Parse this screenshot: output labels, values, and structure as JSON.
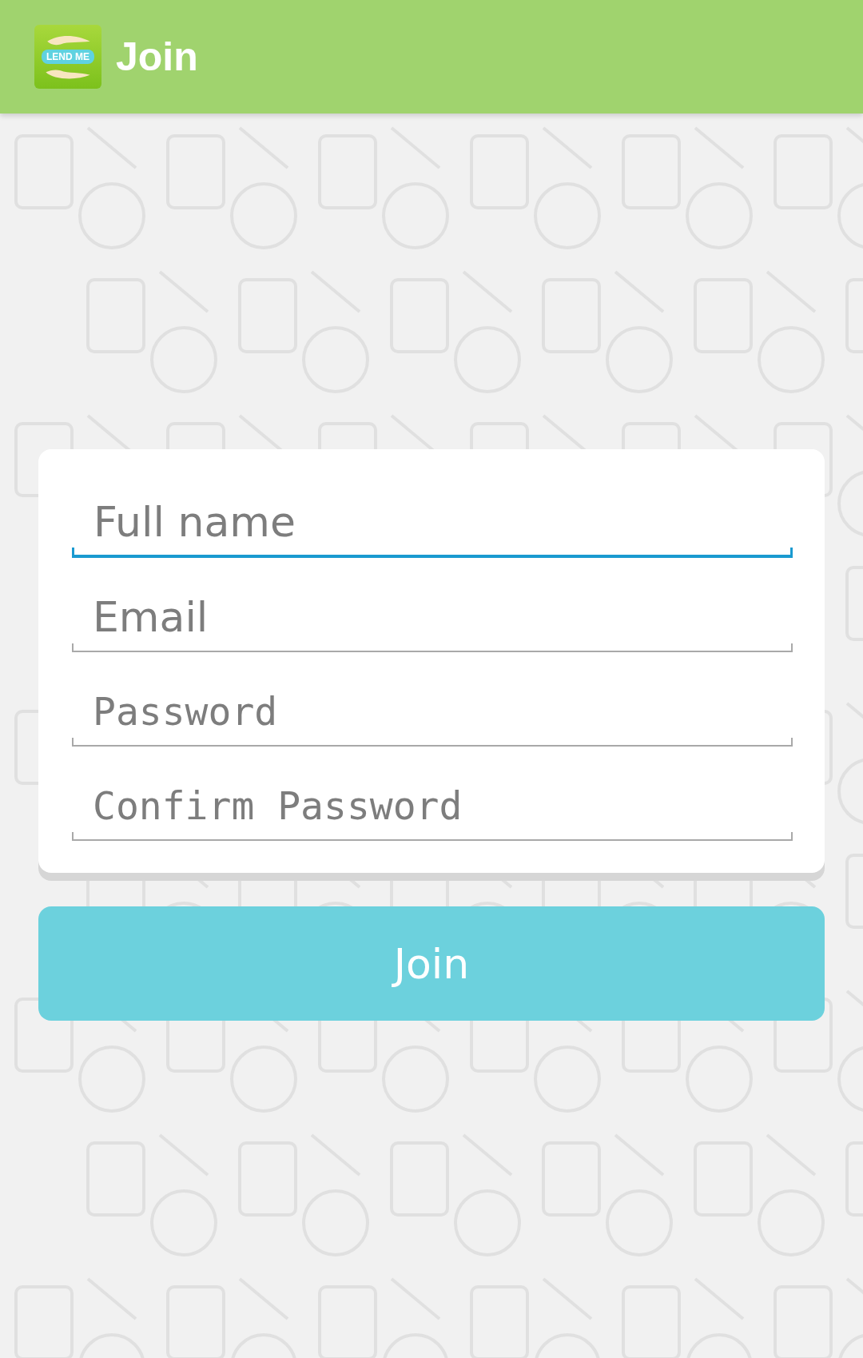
{
  "app_bar": {
    "logo_text": "LEND ME",
    "title": "Join"
  },
  "form": {
    "fields": [
      {
        "kind": "text",
        "placeholder": "Full name",
        "focused": true
      },
      {
        "kind": "text",
        "placeholder": "Email",
        "focused": false
      },
      {
        "kind": "password",
        "placeholder": "Password",
        "focused": false
      },
      {
        "kind": "password",
        "placeholder": "Confirm Password",
        "focused": false
      }
    ]
  },
  "submit_button": {
    "label": "Join"
  }
}
